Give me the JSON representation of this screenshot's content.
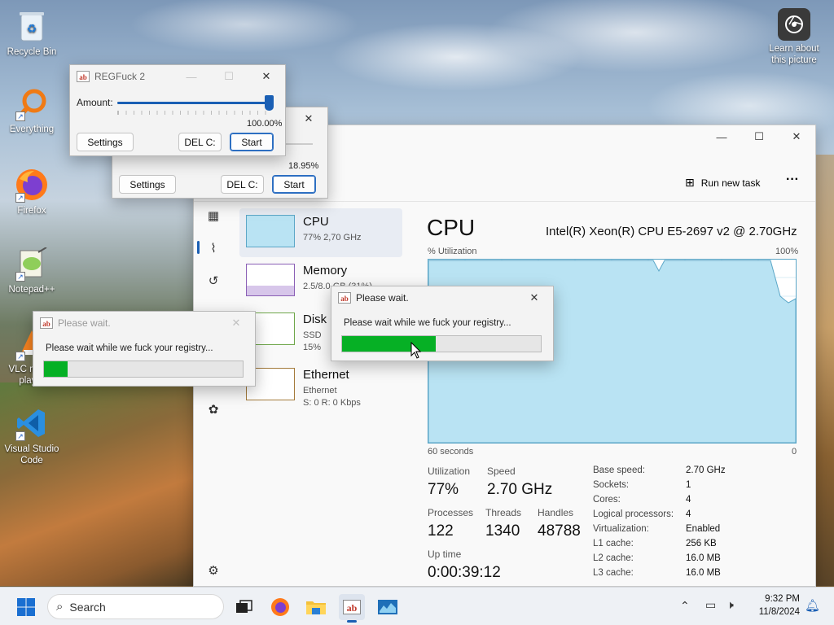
{
  "desktop": {
    "icons": [
      {
        "label": "Recycle Bin",
        "icon": "recycle-bin-icon"
      },
      {
        "label": "Everything",
        "icon": "everything-search-icon"
      },
      {
        "label": "Firefox",
        "icon": "firefox-icon"
      },
      {
        "label": "Notepad++",
        "icon": "notepadpp-icon"
      },
      {
        "label": "VLC media player",
        "icon": "vlc-icon"
      },
      {
        "label": "Visual Studio Code",
        "icon": "vscode-icon"
      }
    ],
    "learn_about": "Learn about this picture"
  },
  "regfuck_front": {
    "title": "REGFuck 2",
    "amount_label": "Amount:",
    "amount_value": "100.00%",
    "amount_fraction": 1.0,
    "settings_label": "Settings",
    "del_label": "DEL C:",
    "start_label": "Start"
  },
  "regfuck_back": {
    "amount_value": "18.95%",
    "settings_label": "Settings",
    "del_label": "DEL C:",
    "start_label": "Start"
  },
  "wait_dialog_left": {
    "title": "Please wait.",
    "message": "Please wait while we fuck your registry...",
    "progress_fraction": 0.12
  },
  "wait_dialog_center": {
    "title": "Please wait.",
    "message": "Please wait while we fuck your registry...",
    "progress_fraction": 0.47
  },
  "taskmgr": {
    "run_new_task": "Run new task",
    "more": "···",
    "perf_items": [
      {
        "name": "CPU",
        "sub": "77% 2,70 GHz"
      },
      {
        "name": "Memory",
        "sub": "2.5/8.0 GB (31%)"
      },
      {
        "name": "Disk 0",
        "sub": "SSD",
        "sub2": "15%"
      },
      {
        "name": "Ethernet",
        "sub": "Ethernet",
        "sub2": "S: 0 R: 0 Kbps"
      }
    ],
    "heading": "CPU",
    "cpu_model": "Intel(R) Xeon(R) CPU E5-2697 v2 @ 2.70GHz",
    "util_label": "% Utilization",
    "util_max": "100%",
    "time_label": "60 seconds",
    "time_min": "0",
    "stats": {
      "utilization_label": "Utilization",
      "utilization": "77%",
      "speed_label": "Speed",
      "speed": "2.70 GHz",
      "processes_label": "Processes",
      "processes": "122",
      "threads_label": "Threads",
      "threads": "1340",
      "handles_label": "Handles",
      "handles": "48788",
      "uptime_label": "Up time",
      "uptime": "0:00:39:12"
    },
    "specs": [
      {
        "k": "Base speed:",
        "v": "2.70 GHz"
      },
      {
        "k": "Sockets:",
        "v": "1"
      },
      {
        "k": "Cores:",
        "v": "4"
      },
      {
        "k": "Logical processors:",
        "v": "4"
      },
      {
        "k": "Virtualization:",
        "v": "Enabled"
      },
      {
        "k": "L1 cache:",
        "v": "256 KB"
      },
      {
        "k": "L2 cache:",
        "v": "16.0 MB"
      },
      {
        "k": "L3 cache:",
        "v": "16.0 MB"
      }
    ]
  },
  "taskbar": {
    "search_placeholder": "Search",
    "time": "9:32 PM",
    "date": "11/8/2024"
  },
  "colors": {
    "graph_fill": "#b9e3f3",
    "graph_line": "#5ba6c7",
    "progress_green": "#06b025",
    "accent": "#1a5fb4"
  }
}
